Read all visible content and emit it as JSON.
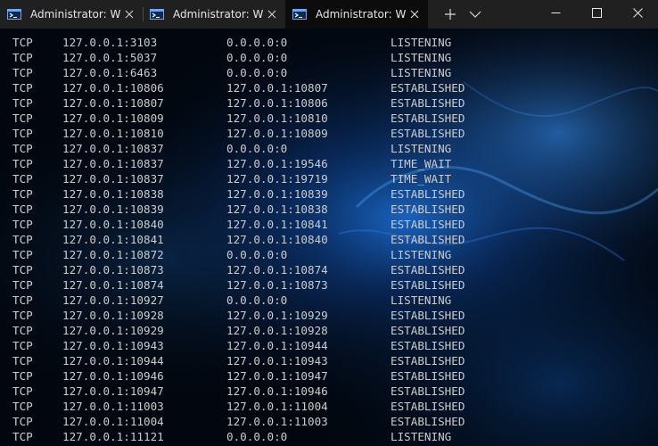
{
  "tabs": [
    {
      "title": "Administrator: W",
      "active": false
    },
    {
      "title": "Administrator: W",
      "active": false
    },
    {
      "title": "Administrator: W",
      "active": true
    }
  ],
  "icons": {
    "new_tab": "plus-icon",
    "dropdown": "chevron-down-icon",
    "minimize": "minimize-icon",
    "maximize": "maximize-icon",
    "close": "close-icon",
    "tab_close": "close-icon",
    "tab": "terminal-icon"
  },
  "colors": {
    "titlebar": "#202020",
    "active_tab": "#0c0c0c",
    "text": "#cccccc",
    "accent": "#1e7fe8"
  },
  "connections": [
    {
      "proto": "TCP",
      "local": "127.0.0.1:3103",
      "foreign": "0.0.0.0:0",
      "state": "LISTENING"
    },
    {
      "proto": "TCP",
      "local": "127.0.0.1:5037",
      "foreign": "0.0.0.0:0",
      "state": "LISTENING"
    },
    {
      "proto": "TCP",
      "local": "127.0.0.1:6463",
      "foreign": "0.0.0.0:0",
      "state": "LISTENING"
    },
    {
      "proto": "TCP",
      "local": "127.0.0.1:10806",
      "foreign": "127.0.0.1:10807",
      "state": "ESTABLISHED"
    },
    {
      "proto": "TCP",
      "local": "127.0.0.1:10807",
      "foreign": "127.0.0.1:10806",
      "state": "ESTABLISHED"
    },
    {
      "proto": "TCP",
      "local": "127.0.0.1:10809",
      "foreign": "127.0.0.1:10810",
      "state": "ESTABLISHED"
    },
    {
      "proto": "TCP",
      "local": "127.0.0.1:10810",
      "foreign": "127.0.0.1:10809",
      "state": "ESTABLISHED"
    },
    {
      "proto": "TCP",
      "local": "127.0.0.1:10837",
      "foreign": "0.0.0.0:0",
      "state": "LISTENING"
    },
    {
      "proto": "TCP",
      "local": "127.0.0.1:10837",
      "foreign": "127.0.0.1:19546",
      "state": "TIME_WAIT"
    },
    {
      "proto": "TCP",
      "local": "127.0.0.1:10837",
      "foreign": "127.0.0.1:19719",
      "state": "TIME_WAIT"
    },
    {
      "proto": "TCP",
      "local": "127.0.0.1:10838",
      "foreign": "127.0.0.1:10839",
      "state": "ESTABLISHED"
    },
    {
      "proto": "TCP",
      "local": "127.0.0.1:10839",
      "foreign": "127.0.0.1:10838",
      "state": "ESTABLISHED"
    },
    {
      "proto": "TCP",
      "local": "127.0.0.1:10840",
      "foreign": "127.0.0.1:10841",
      "state": "ESTABLISHED"
    },
    {
      "proto": "TCP",
      "local": "127.0.0.1:10841",
      "foreign": "127.0.0.1:10840",
      "state": "ESTABLISHED"
    },
    {
      "proto": "TCP",
      "local": "127.0.0.1:10872",
      "foreign": "0.0.0.0:0",
      "state": "LISTENING"
    },
    {
      "proto": "TCP",
      "local": "127.0.0.1:10873",
      "foreign": "127.0.0.1:10874",
      "state": "ESTABLISHED"
    },
    {
      "proto": "TCP",
      "local": "127.0.0.1:10874",
      "foreign": "127.0.0.1:10873",
      "state": "ESTABLISHED"
    },
    {
      "proto": "TCP",
      "local": "127.0.0.1:10927",
      "foreign": "0.0.0.0:0",
      "state": "LISTENING"
    },
    {
      "proto": "TCP",
      "local": "127.0.0.1:10928",
      "foreign": "127.0.0.1:10929",
      "state": "ESTABLISHED"
    },
    {
      "proto": "TCP",
      "local": "127.0.0.1:10929",
      "foreign": "127.0.0.1:10928",
      "state": "ESTABLISHED"
    },
    {
      "proto": "TCP",
      "local": "127.0.0.1:10943",
      "foreign": "127.0.0.1:10944",
      "state": "ESTABLISHED"
    },
    {
      "proto": "TCP",
      "local": "127.0.0.1:10944",
      "foreign": "127.0.0.1:10943",
      "state": "ESTABLISHED"
    },
    {
      "proto": "TCP",
      "local": "127.0.0.1:10946",
      "foreign": "127.0.0.1:10947",
      "state": "ESTABLISHED"
    },
    {
      "proto": "TCP",
      "local": "127.0.0.1:10947",
      "foreign": "127.0.0.1:10946",
      "state": "ESTABLISHED"
    },
    {
      "proto": "TCP",
      "local": "127.0.0.1:11003",
      "foreign": "127.0.0.1:11004",
      "state": "ESTABLISHED"
    },
    {
      "proto": "TCP",
      "local": "127.0.0.1:11004",
      "foreign": "127.0.0.1:11003",
      "state": "ESTABLISHED"
    },
    {
      "proto": "TCP",
      "local": "127.0.0.1:11121",
      "foreign": "0.0.0.0:0",
      "state": "LISTENING"
    }
  ]
}
